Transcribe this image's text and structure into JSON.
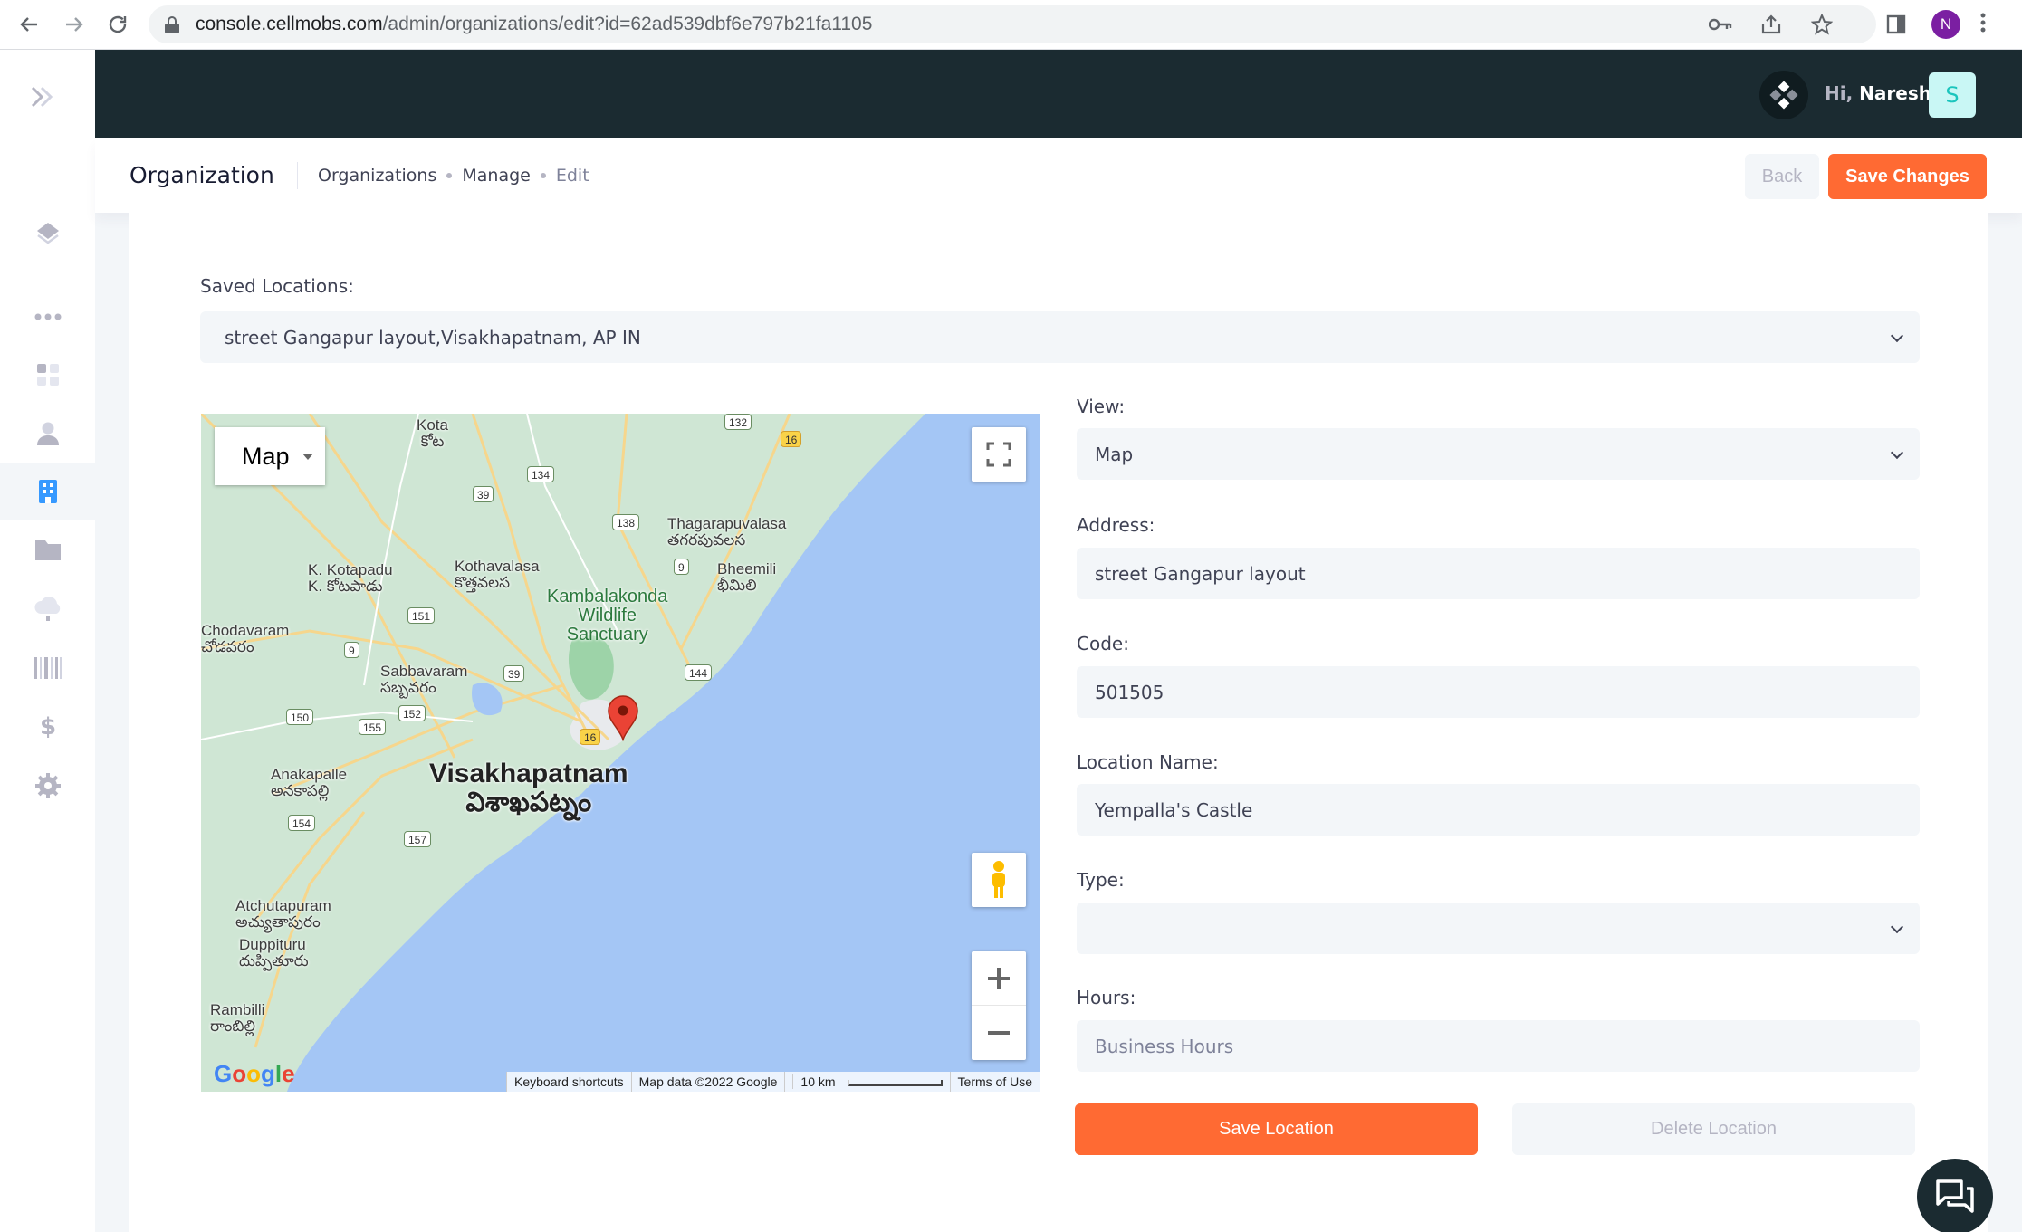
{
  "browser": {
    "url_host": "console.cellmobs.com",
    "url_path": "/admin/organizations/edit?id=62ad539dbf6e797b21fa1105",
    "profile_initial": "N"
  },
  "header": {
    "greeting_hi": "Hi,",
    "greeting_name": "Naresh",
    "user_initial": "S"
  },
  "subheader": {
    "title": "Organization",
    "breadcrumb": [
      "Organizations",
      "Manage",
      "Edit"
    ],
    "back_label": "Back",
    "save_changes_label": "Save Changes"
  },
  "form": {
    "saved_locations_label": "Saved Locations:",
    "saved_locations_value": "street Gangapur layout,Visakhapatnam, AP IN",
    "view_label": "View:",
    "view_value": "Map",
    "address_label": "Address:",
    "address_value": "street Gangapur layout",
    "code_label": "Code:",
    "code_value": "501505",
    "location_name_label": "Location Name:",
    "location_name_value": "Yempalla's Castle",
    "type_label": "Type:",
    "type_value": "",
    "hours_label": "Hours:",
    "hours_placeholder": "Business Hours",
    "save_location_label": "Save Location",
    "delete_location_label": "Delete Location"
  },
  "map": {
    "type_label": "Map",
    "places": {
      "kota": "Kota",
      "kota_te": "కోట",
      "kotapadu": "K. Kotapadu",
      "kotapadu_te": "K. కోటపాడు",
      "kothavalasa": "Kothavalasa",
      "kothavalasa_te": "కొత్తవలస",
      "thagarapuvalasa": "Thagarapuvalasa",
      "thagarapuvalasa_te": "తగరపువలస",
      "bheemili": "Bheemili",
      "bheemili_te": "భీమిలి",
      "kambalakonda": "Kambalakonda",
      "wildlife": "Wildlife",
      "sanctuary": "Sanctuary",
      "chodavaram": "Chodavaram",
      "chodavaram_te": "చోడవరం",
      "sabbavaram": "Sabbavaram",
      "sabbavaram_te": "సబ్బవరం",
      "visakhapatnam": "Visakhapatnam",
      "visakhapatnam_te": "విశాఖపట్నం",
      "anakapalle": "Anakapalle",
      "anakapalle_te": "అనకాపల్లి",
      "atchutapuram": "Atchutapuram",
      "atchutapuram_te": "అచ్యుతాపురం",
      "duppituru": "Duppituru",
      "duppituru_te": "దుప్పితూరు",
      "rambilli": "Rambilli",
      "rambilli_te": "రాంబిల్లి"
    },
    "shields": [
      "132",
      "16",
      "134",
      "39",
      "138",
      "9",
      "151",
      "9",
      "39",
      "144",
      "150",
      "155",
      "152",
      "16",
      "154",
      "157"
    ],
    "footer": {
      "shortcuts": "Keyboard shortcuts",
      "map_data": "Map data ©2022 Google",
      "scale": "10 km",
      "terms": "Terms of Use"
    },
    "google_logo": "Google"
  }
}
